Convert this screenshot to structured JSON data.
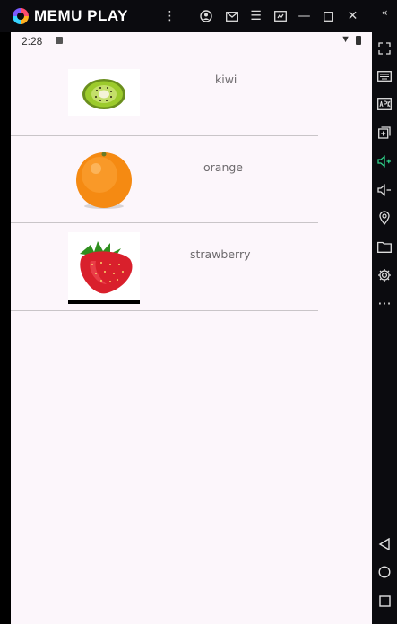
{
  "emulator": {
    "brand": "MEMU PLAY",
    "title_bar_icons": [
      "more-vert-icon",
      "user-icon",
      "mail-icon",
      "menu-icon",
      "screen-icon",
      "minimize-icon",
      "maximize-icon",
      "close-icon"
    ],
    "sidebar_icons": [
      "collapse-icon",
      "fullscreen-icon",
      "keyboard-icon",
      "apk-icon",
      "add-window-icon",
      "volume-up-icon",
      "volume-down-icon",
      "location-icon",
      "folder-icon",
      "settings-icon",
      "more-icon"
    ],
    "nav_icons": [
      "back-icon",
      "home-icon",
      "recents-icon"
    ],
    "accent": "#2fd38a"
  },
  "status": {
    "time": "2:28"
  },
  "items": [
    {
      "label": "kiwi"
    },
    {
      "label": "orange"
    },
    {
      "label": "strawberry"
    }
  ]
}
